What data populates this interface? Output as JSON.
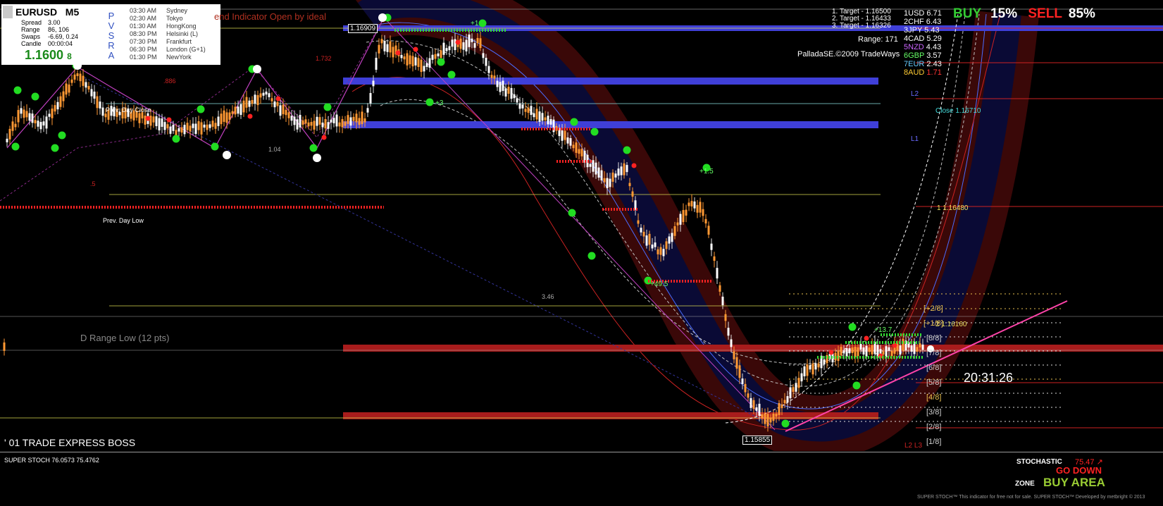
{
  "info_box": {
    "symbol": "EURUSD",
    "timeframe": "M5",
    "rows": [
      {
        "label": "Spread",
        "value": "3.00"
      },
      {
        "label": "Range",
        "value": "86, 106"
      },
      {
        "label": "Swaps",
        "value": "-6.69, 0.24"
      },
      {
        "label": "Candle",
        "value": "00:00:04"
      }
    ],
    "price": "1.1600",
    "price_fraction": "8",
    "pvsra_letters": [
      "P",
      "V",
      "S",
      "R",
      "A"
    ],
    "sessions": [
      {
        "time": "03:30 AM",
        "city": "Sydney"
      },
      {
        "time": "02:30 AM",
        "city": "Tokyo"
      },
      {
        "time": "01:30 AM",
        "city": "HongKong"
      },
      {
        "time": "08:30 PM",
        "city": "Helsinki  (L)"
      },
      {
        "time": "07:30 PM",
        "city": "Frankfurt"
      },
      {
        "time": "06:30 PM",
        "city": "London   (G+1)"
      },
      {
        "time": "01:30 PM",
        "city": "NewYork"
      }
    ]
  },
  "overlay_title": "end Indicator Open by ideal",
  "targets": [
    "1. Target - 1.16500",
    "2. Target - 1.16433",
    "3. Target - 1.16326"
  ],
  "range_text": "Range: 171",
  "copyright": "PalladaSE.©2009 TradeWays",
  "currency_strength": [
    {
      "rank": "1",
      "currency": "USD",
      "value": "6.71",
      "color": "#ffffff"
    },
    {
      "rank": "2",
      "currency": "CHF",
      "value": "6.43",
      "color": "#ffffff"
    },
    {
      "rank": "3",
      "currency": "JPY",
      "value": "5.43",
      "color": "#ffffff"
    },
    {
      "rank": "4",
      "currency": "CAD",
      "value": "5.29",
      "color": "#ffffff"
    },
    {
      "rank": "5",
      "currency": "NZD",
      "value": "4.43",
      "color": "#cc66ff"
    },
    {
      "rank": "6",
      "currency": "GBP",
      "value": "3.57",
      "color": "#66ff66"
    },
    {
      "rank": "7",
      "currency": "EUR",
      "value": "2.43",
      "color": "#66ccff"
    },
    {
      "rank": "8",
      "currency": "AUD",
      "value": "1.71",
      "color": "#ffcc33"
    }
  ],
  "sentiment": {
    "buy_label": "BUY",
    "buy_pct": "15%",
    "sell_label": "SELL",
    "sell_pct": "85%"
  },
  "price_labels": {
    "top_box": "1.16909",
    "bottom_box": "1.15855",
    "close": "Close 1.16710",
    "level_1": "1 1.16480",
    "level_2": "2 1.16160"
  },
  "zone_labels": {
    "l2": "L2",
    "l1": "L1",
    "l2_l3": "L2 L3"
  },
  "chart_labels": {
    "prev_day_low": "Prev. Day Low",
    "prev_day_close": "Prev. Day Close",
    "d_range_low": "D Range Low (12 pts)",
    "brand": "' 01 TRADE EXPRESS BOSS",
    "clock": "20:31:26"
  },
  "fib_labels": [
    ".886",
    "1.732",
    "1.04",
    ".5",
    "3.46"
  ],
  "gain_labels": [
    "+1.5",
    "+49.5",
    "+13.7",
    "+3",
    "+1"
  ],
  "murrey_levels": [
    "[+2/8]",
    "[+1/8]",
    "[8/8]",
    "[7/8]",
    "[6/8]",
    "[5/8]",
    "[4/8]",
    "[3/8]",
    "[2/8]",
    "[1/8]"
  ],
  "stoch_panel": {
    "title": "SUPER STOCH 76.0573 75.4762",
    "stochastic_label": "STOCHASTIC",
    "stochastic_value": "75.47",
    "arrow": "↗",
    "signal": "GO DOWN",
    "zone_label": "ZONE",
    "zone_value": "BUY AREA",
    "footer": "SUPER STOCH™ This indicator for free not for sale. SUPER STOCH™ Developed by metbright © 2013"
  },
  "colors": {
    "background": "#000000",
    "bull_candle": "#ffffff",
    "bear_candle": "#ff9933",
    "zone_blue": "#3f3fd8",
    "zone_red": "#a81c1c",
    "buy": "#33cc33",
    "sell": "#ff2222",
    "trendline": "#ff44aa"
  }
}
